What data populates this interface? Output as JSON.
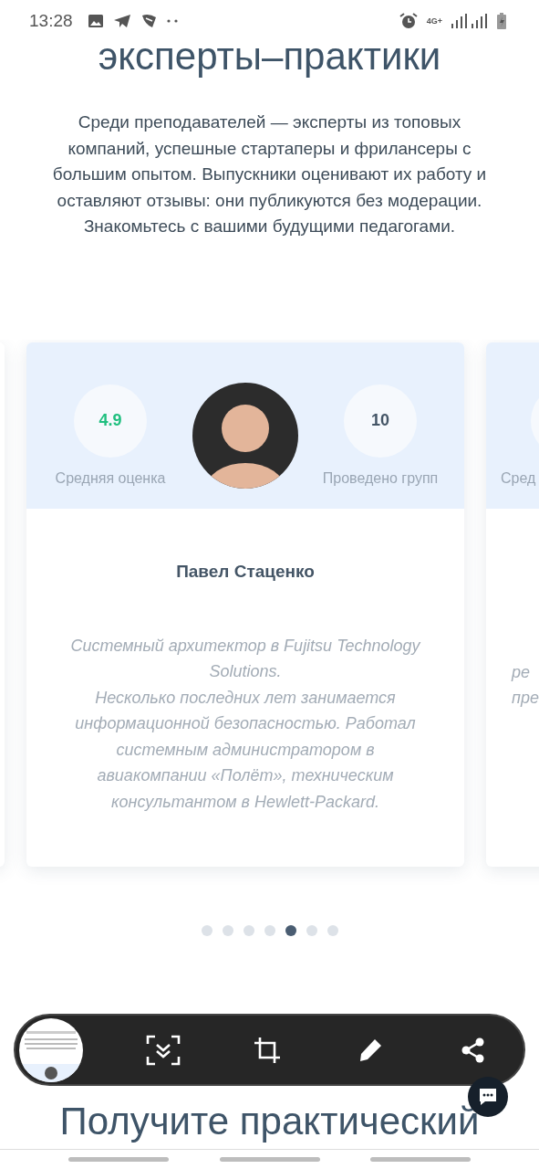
{
  "status_bar": {
    "time": "13:28",
    "network": "4G+"
  },
  "heading": "эксперты–практики",
  "intro": "Среди преподавателей — эксперты из топовых компаний, успешные стартаперы и фрилансеры с большим опытом. Выпускники оценивают их работу и оставляют отзывы: они публикуются без модерации. Знакомьтесь с вашими будущими педагогами.",
  "cards": [
    {
      "stats": [
        {
          "value": "4.9",
          "label": "Средняя оценка",
          "kind": "rating"
        },
        {
          "value": "10",
          "label": "Проведено групп",
          "kind": "count"
        }
      ],
      "name": "Павел Стаценко",
      "description": [
        "Системный архитектор в Fujitsu Technology Solutions.",
        "Несколько последних лет занимается информационной безопасностью. Работал системным администратором в авиакомпании «Полёт», техническим консультантом в Hewlett-Packard."
      ]
    },
    {
      "stats": [
        {
          "label": "Сред",
          "kind": "rating"
        }
      ],
      "description": [
        "ре",
        "пре"
      ]
    }
  ],
  "dots": [
    {
      "selected": false
    },
    {
      "selected": false
    },
    {
      "selected": false
    },
    {
      "selected": false
    },
    {
      "selected": true
    },
    {
      "selected": false
    },
    {
      "selected": false
    }
  ],
  "screenshot_toolbar": {
    "tools": [
      {
        "kind": "scroll"
      },
      {
        "kind": "crop"
      },
      {
        "kind": "draw"
      },
      {
        "kind": "share"
      }
    ]
  },
  "next_heading": "Получите практический"
}
